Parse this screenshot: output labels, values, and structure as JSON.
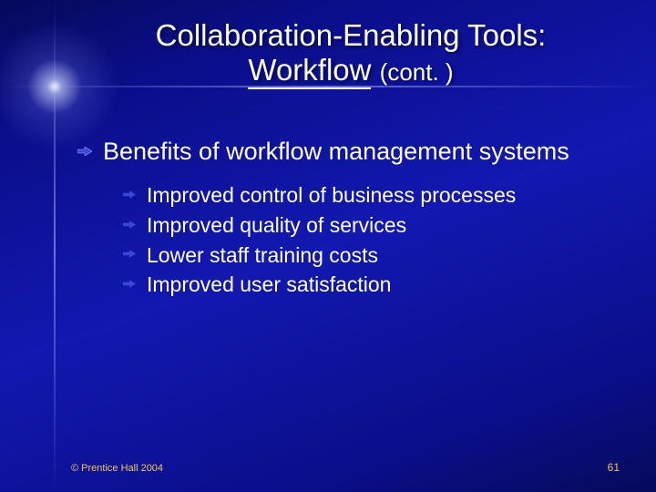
{
  "title": {
    "line1": "Collaboration-Enabling Tools:",
    "line2_main": "Workflow",
    "line2_cont": "(cont. )"
  },
  "body": {
    "heading": "Benefits of workflow management systems",
    "items": [
      "Improved control of business processes",
      "Improved quality of services",
      "Lower staff training costs",
      "Improved user satisfaction"
    ]
  },
  "footer": {
    "copyright": "© Prentice Hall 2004",
    "page": "61"
  },
  "colors": {
    "bullet_fill": "#3a46d8",
    "bullet_stroke": "#9aa4ff"
  }
}
